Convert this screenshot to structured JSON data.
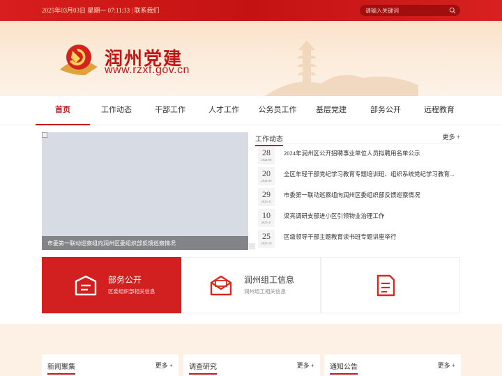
{
  "topbar": {
    "info": "2025年03月03日 星期一 07:11:33 | 联系我们",
    "search_placeholder": "请输入关键词"
  },
  "banner": {
    "site_name": "润州党建",
    "site_url": "www.rzxf.gov.cn"
  },
  "nav": {
    "items": [
      {
        "label": "首页",
        "active": true
      },
      {
        "label": "工作动态"
      },
      {
        "label": "干部工作"
      },
      {
        "label": "人才工作"
      },
      {
        "label": "公务员工作"
      },
      {
        "label": "基层党建"
      },
      {
        "label": "部务公开"
      },
      {
        "label": "远程教育"
      }
    ]
  },
  "slideshow": {
    "caption": "市委第一联动巡察组向润州区委组织部反馈巡察情况",
    "dot_count": 5,
    "active_dot": 2
  },
  "news": {
    "title": "工作动态",
    "more": "更多 +",
    "items": [
      {
        "day": "28",
        "ym": "2024-06",
        "title": "2024年润州区公开招聘事业单位人员拟聘用名单公示"
      },
      {
        "day": "20",
        "ym": "2024-06",
        "title": "全区年轻干部党纪学习教育专题培训班、组织系统党纪学习教育..."
      },
      {
        "day": "29",
        "ym": "2023-11",
        "title": "市委第一联动巡察组向润州区委组织部反馈巡察情况"
      },
      {
        "day": "10",
        "ym": "2023-11",
        "title": "梁亮调研支部进小区引领物业治理工作"
      },
      {
        "day": "25",
        "ym": "2023-10",
        "title": "区级领导干部主题教育读书班专题讲座举行"
      }
    ]
  },
  "cards": [
    {
      "title": "部务公开",
      "sub": "区委组织部相关信息",
      "icon": "newspaper-icon"
    },
    {
      "title": "润州组工信息",
      "sub": "润州组工相关信息",
      "icon": "mail-icon"
    },
    {
      "title": "",
      "sub": "",
      "icon": "document-icon"
    }
  ],
  "bottom_panels": [
    {
      "title": "新闻聚集",
      "more": "更多 +"
    },
    {
      "title": "调查研究",
      "more": "更多 +"
    },
    {
      "title": "通知公告",
      "more": "更多 +"
    }
  ],
  "colors": {
    "primary_red": "#c8161d",
    "card_red": "#d21f1f"
  }
}
